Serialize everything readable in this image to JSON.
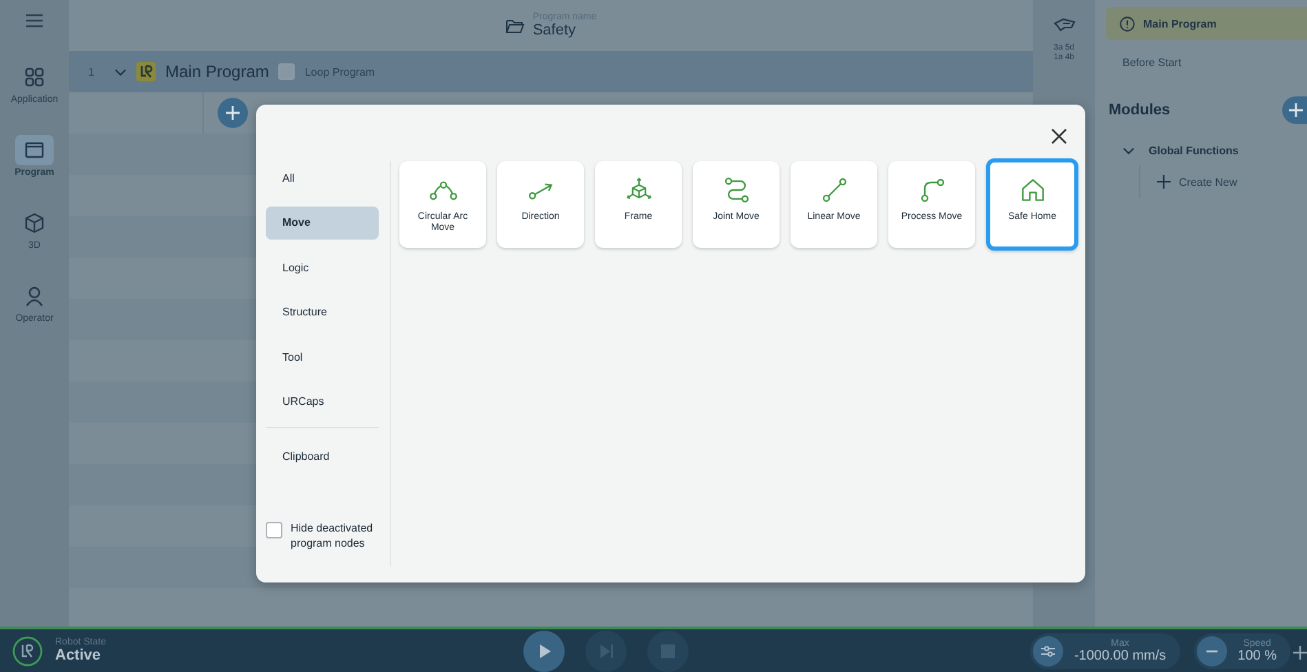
{
  "nav": [
    {
      "label": "Application",
      "kind": "grid",
      "selected": false
    },
    {
      "label": "Program",
      "kind": "window",
      "selected": true
    },
    {
      "label": "3D",
      "kind": "cube",
      "selected": false
    },
    {
      "label": "Operator",
      "kind": "person",
      "selected": false
    }
  ],
  "header": {
    "caption": "Program name",
    "program_name": "Safety"
  },
  "program_tree": {
    "line_number": "1",
    "expanded": true,
    "title": "Main Program",
    "loop": {
      "label": "Loop Program",
      "checked": false
    }
  },
  "robot_id": [
    "3a 5d",
    "1a 4b"
  ],
  "side_panel": {
    "main_program": "Main Program",
    "before_start": "Before Start",
    "modules_title": "Modules",
    "modules": [
      {
        "label": "Global Functions",
        "expanded": true,
        "action": "Create New"
      }
    ]
  },
  "dialog": {
    "categories": [
      {
        "label": "All",
        "selected": false
      },
      {
        "label": "Move",
        "selected": true
      },
      {
        "label": "Logic",
        "selected": false
      },
      {
        "label": "Structure",
        "selected": false
      },
      {
        "label": "Tool",
        "selected": false
      },
      {
        "label": "URCaps",
        "selected": false
      }
    ],
    "clipboard": {
      "label": "Clipboard",
      "selected": false
    },
    "hide_deactivated": {
      "label": "Hide deactivated program nodes",
      "checked": false
    },
    "nodes": [
      {
        "label": "Circular Arc Move",
        "kind": "arc",
        "selected": false
      },
      {
        "label": "Direction",
        "kind": "direction",
        "selected": false
      },
      {
        "label": "Frame",
        "kind": "frame",
        "selected": false
      },
      {
        "label": "Joint Move",
        "kind": "joint",
        "selected": false
      },
      {
        "label": "Linear Move",
        "kind": "linear",
        "selected": false
      },
      {
        "label": "Process Move",
        "kind": "process",
        "selected": false
      },
      {
        "label": "Safe Home",
        "kind": "home",
        "selected": true
      }
    ]
  },
  "status_bar": {
    "robot_state_label": "Robot State",
    "robot_state": "Active",
    "max_label": "Max",
    "max_value": "-1000.00 mm/s",
    "speed_label": "Speed",
    "speed_value": "100 %"
  }
}
